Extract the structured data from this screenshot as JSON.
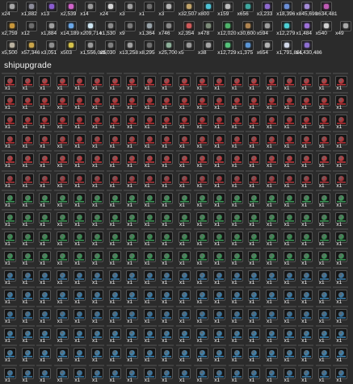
{
  "inventory_top": {
    "rows": [
      [
        {
          "icon": "asteroid-ore-icon",
          "qty": "x24",
          "color": "#a7a7a7"
        },
        {
          "icon": "dark-crystal-icon",
          "qty": "x1,882",
          "color": "#8c8c9a"
        },
        {
          "icon": "violet-crystal-icon",
          "qty": "x13",
          "color": "#8a5ccf"
        },
        {
          "icon": "pink-crystal-icon",
          "qty": "x2,539",
          "color": "#d063c9"
        },
        {
          "icon": "grey-mineral-icon",
          "qty": "x14",
          "color": "#9a9a9a"
        },
        {
          "icon": "white-mineral-icon",
          "qty": "x24",
          "color": "#d8d8d8"
        },
        {
          "icon": "cluster-ore-icon",
          "qty": "x3",
          "color": "#9f9f9f"
        },
        {
          "icon": "black-ore-icon",
          "qty": "x1",
          "color": "#6e6e6e"
        },
        {
          "icon": "rock-ore-icon",
          "qty": "x3",
          "color": "#b5b5b5"
        },
        {
          "icon": "tan-ore-icon",
          "qty": "x32,507",
          "color": "#c2a46b"
        },
        {
          "icon": "cyan-crystal-icon",
          "qty": "x800",
          "color": "#4fc3d6"
        },
        {
          "icon": "silver-ore-icon",
          "qty": "x159",
          "color": "#bcbcbc"
        },
        {
          "icon": "teal-crystal-icon",
          "qty": "x656",
          "color": "#3fa8a0"
        },
        {
          "icon": "purple-shard-icon",
          "qty": "x3,233",
          "color": "#8f6ad0"
        },
        {
          "icon": "blue-shard-icon",
          "qty": "x18,396",
          "color": "#6b8fd8"
        },
        {
          "icon": "lavender-shard-icon",
          "qty": "x845,690",
          "color": "#a58bd8"
        },
        {
          "icon": "magenta-shard-icon",
          "qty": "x634,481",
          "color": "#c05bb5"
        }
      ],
      [
        {
          "icon": "amber-ore-icon",
          "qty": "x2,759",
          "color": "#c8963a"
        },
        {
          "icon": "dark-ore-icon",
          "qty": "x12",
          "color": "#6d6d6d"
        },
        {
          "icon": "grey-ring-icon",
          "qty": "x1,884",
          "color": "#a0a0a0"
        },
        {
          "icon": "blue-diamond-icon",
          "qty": "x14,189",
          "color": "#6aa6e6"
        },
        {
          "icon": "ice-block-icon",
          "qty": "x209,714",
          "color": "#cfe6f2"
        },
        {
          "icon": "gear-part-icon",
          "qty": "x1,530",
          "color": "#8b8b8b"
        },
        {
          "icon": "lens-part-icon",
          "qty": "x9",
          "color": "#7a7a7a"
        },
        {
          "icon": "chip-part-icon",
          "qty": "x1,364",
          "color": "#9aa4aa"
        },
        {
          "icon": "coil-part-icon",
          "qty": "x746",
          "color": "#898989"
        },
        {
          "icon": "red-crystal-icon",
          "qty": "x2,354",
          "color": "#d05a5a"
        },
        {
          "icon": "circuit-part-icon",
          "qty": "x478",
          "color": "#7d8c7a"
        },
        {
          "icon": "green-crystal-icon",
          "qty": "x12,020",
          "color": "#4fb36a"
        },
        {
          "icon": "bronze-ore-icon",
          "qty": "x30,600",
          "color": "#b08450"
        },
        {
          "icon": "frame-part-icon",
          "qty": "x594",
          "color": "#9d9d9d"
        },
        {
          "icon": "cyan-gem-icon",
          "qty": "x12,279",
          "color": "#4ccfd4"
        },
        {
          "icon": "violet-gem-icon",
          "qty": "x1,484",
          "color": "#9d70d8"
        },
        {
          "icon": "pale-gem-icon",
          "qty": "x540",
          "color": "#cfcfcf"
        },
        {
          "icon": "steel-part-icon",
          "qty": "x49",
          "color": "#a8a8a8"
        }
      ],
      [
        {
          "icon": "shell-part-icon",
          "qty": "x5,500",
          "color": "#b9b1a0"
        },
        {
          "icon": "gold-ore-icon",
          "qty": "x57,346",
          "color": "#caa54a"
        },
        {
          "icon": "mesh-part-icon",
          "qty": "x3,051",
          "color": "#8f8f8f"
        },
        {
          "icon": "yellow-gem-icon",
          "qty": "x503",
          "color": "#d6c24a"
        },
        {
          "icon": "spiral-part-icon",
          "qty": "x1,556,025",
          "color": "#9a9a9a"
        },
        {
          "icon": "gear-cluster-icon",
          "qty": "x8,030",
          "color": "#7f7f7f"
        },
        {
          "icon": "cog-part-icon",
          "qty": "x13,258",
          "color": "#a2a2a2"
        },
        {
          "icon": "dark-gem-icon",
          "qty": "x8,295",
          "color": "#707070"
        },
        {
          "icon": "tendril-part-icon",
          "qty": "x25,700",
          "color": "#8eb09a"
        },
        {
          "icon": "node-part-icon",
          "qty": "x5",
          "color": "#9a9a9a"
        },
        {
          "icon": "plate-part-icon",
          "qty": "x38",
          "color": "#a5a5a5"
        },
        {
          "icon": "emerald-gem-icon",
          "qty": "x12,729",
          "color": "#55c27a"
        },
        {
          "icon": "azure-gem-icon",
          "qty": "x1,375",
          "color": "#5a95d6"
        },
        {
          "icon": "beam-part-icon",
          "qty": "x654",
          "color": "#b3b3b3"
        },
        {
          "icon": "glow-part-icon",
          "qty": "x1,791,851",
          "color": "#d0d6e6"
        },
        {
          "icon": "violet-core-icon",
          "qty": "x4,430,486",
          "color": "#8c6ed0"
        }
      ]
    ]
  },
  "section_title": "shipupgrade",
  "upgrades": {
    "qty_label": "x1",
    "columns": 20,
    "rows": 16,
    "row_colors": [
      "#c0383d",
      "#bb3336",
      "#b52f33",
      "#b83539",
      "#c23a3e",
      "#a8343a",
      "#3f9a5b",
      "#3e9356",
      "#389152",
      "#3c9558",
      "#3b7aa8",
      "#3a7fae",
      "#3576a4",
      "#3b83b2",
      "#3e86b5",
      "#3a7aa8"
    ]
  }
}
